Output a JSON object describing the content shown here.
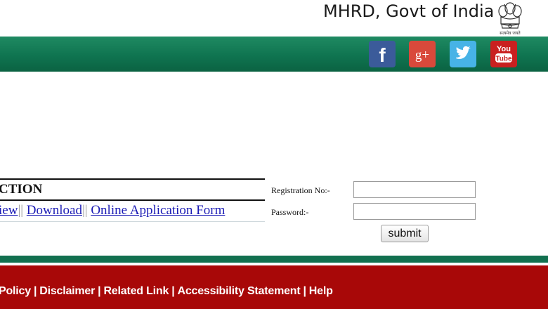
{
  "header": {
    "ministry": "MHRD, Govt of India",
    "emblem_caption": "सत्यमेव जयते"
  },
  "social": [
    {
      "icon": "facebook-icon",
      "glyph": "f",
      "color": "#3b5b9a"
    },
    {
      "icon": "google-plus-icon",
      "glyph": "g+",
      "color": "#d9493b"
    },
    {
      "icon": "twitter-icon",
      "glyph": "bird",
      "color": "#47b3e6"
    },
    {
      "icon": "youtube-icon",
      "glyph": "You Tube",
      "color": "#c92020"
    }
  ],
  "section": {
    "title": "CTION",
    "links": [
      "iew",
      "Download",
      "Online Application Form"
    ],
    "separator": "||"
  },
  "login": {
    "registration_label": "Registration No:-",
    "registration_value": "",
    "password_label": "Password:-",
    "password_value": "",
    "submit_label": "submit"
  },
  "footer": {
    "links": [
      "Policy",
      "Disclaimer",
      "Related Link",
      "Accessibility Statement",
      "Help"
    ],
    "separator": "|"
  },
  "colors": {
    "header_green": "#0f7450",
    "footer_red": "#a80808",
    "link_blue": "#1b1bb5"
  }
}
